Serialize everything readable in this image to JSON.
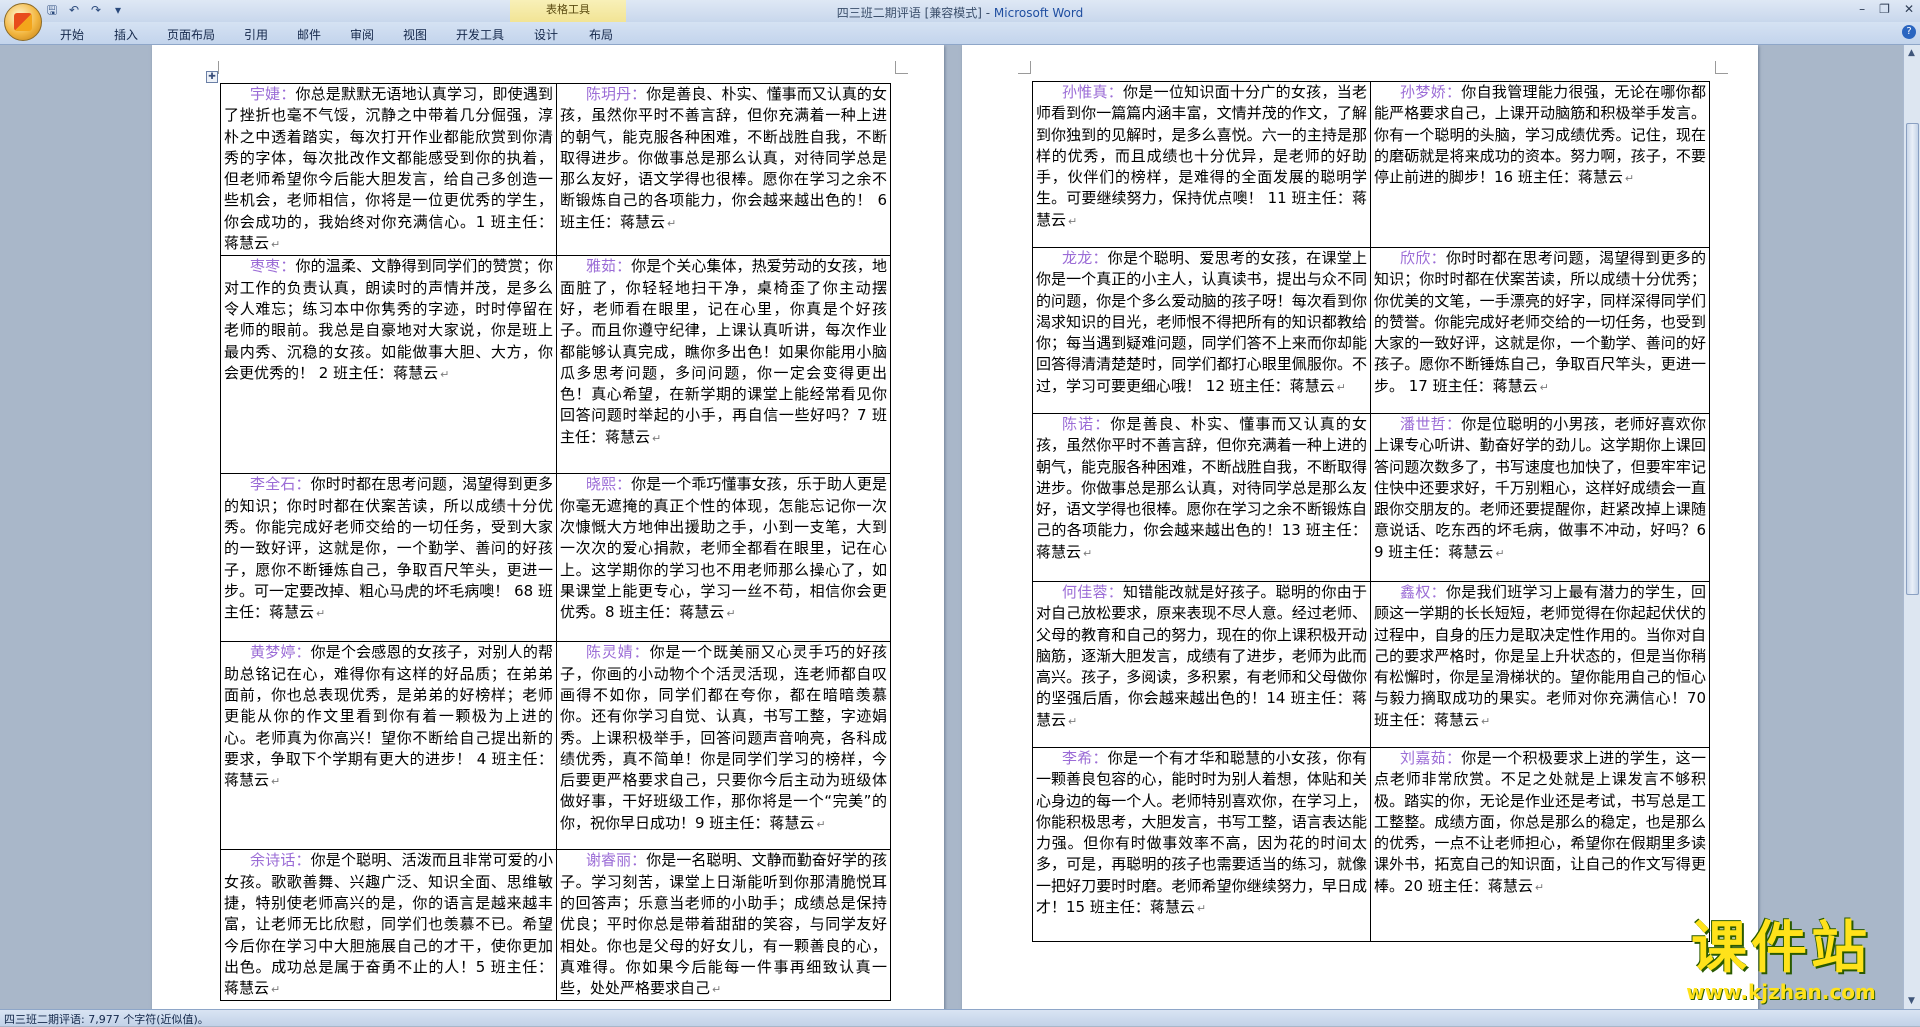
{
  "window": {
    "title_doc": "四三班二期评语 [兼容模式] - ",
    "title_app": "Microsoft Word",
    "context_group": "表格工具"
  },
  "tabs": [
    "开始",
    "插入",
    "页面布局",
    "引用",
    "邮件",
    "审阅",
    "视图",
    "开发工具",
    "设计",
    "布局"
  ],
  "status": {
    "text": "四三班二期评语: 7,977 个字符(近似值)。"
  },
  "watermark": {
    "title": "课件站",
    "url": "www.kjzhan.com"
  },
  "left_page": {
    "rows": [
      [
        {
          "name": "宇婕：",
          "text": "你总是默默无语地认真学习，即使遇到了挫折也毫不气馁，沉静之中带着几分倔强，淳朴之中透着踏实，每次打开作业都能欣赏到你清秀的字体，每次批改作文都能感受到你的执着，但老师希望你今后能大胆发言，给自己多创造一些机会，老师相信，你将是一位更优秀的学生，你会成功的，我始终对你充满信心。1 班主任：蒋慧云"
        },
        {
          "name": "陈玥丹：",
          "text": "你是善良、朴实、懂事而又认真的女孩，虽然你平时不善言辞，但你充满着一种上进的朝气，能克服各种困难，不断战胜自我，不断取得进步。你做事总是那么认真，对待同学总是那么友好，语文学得也很棒。愿你在学习之余不断锻炼自己的各项能力，你会越来越出色的！ 6 班主任：蒋慧云"
        }
      ],
      [
        {
          "name": "枣枣：",
          "text": "你的温柔、文静得到同学们的赞赏；你对工作的负责认真，朗读时的声情并茂，是多么令人难忘；练习本中你隽秀的字迹，时时停留在老师的眼前。我总是自豪地对大家说，你是班上最内秀、沉稳的女孩。如能做事大胆、大方，你会更优秀的！ 2 班主任：蒋慧云"
        },
        {
          "name": "雅茹：",
          "text": "你是个关心集体，热爱劳动的女孩，地面脏了，你轻轻地扫干净，桌椅歪了你主动摆好，老师看在眼里，记在心里，你真是个好孩子。而且你遵守纪律，上课认真听讲，每次作业都能够认真完成，瞧你多出色！如果你能用小脑瓜多思考问题，多问问题，你一定会变得更出色！真心希望，在新学期的课堂上能经常看见你回答问题时举起的小手，再自信一些好吗？7 班主任：蒋慧云"
        }
      ],
      [
        {
          "name": "李全石：",
          "text": "你时时都在思考问题，渴望得到更多的知识；你时时都在伏案苦读，所以成绩十分优秀。你能完成好老师交给的一切任务，受到大家的一致好评，这就是你，一个勤学、善问的好孩子，愿你不断锤炼自己，争取百尺竿头，更进一步。可一定要改掉、粗心马虎的坏毛病噢！ 68 班主任：蒋慧云"
        },
        {
          "name": "晓熙：",
          "text": "你是一个乖巧懂事女孩，乐于助人更是你毫无遮掩的真正个性的体现，怎能忘记你一次次慷慨大方地伸出援助之手，小到一支笔，大到一次次的爱心捐款，老师全都看在眼里，记在心上。这学期你的学习也不用老师那么操心了，如果课堂上能更专心，学习一丝不苟，相信你会更优秀。8 班主任：蒋慧云"
        }
      ],
      [
        {
          "name": "黄梦婷：",
          "text": "你是个会感恩的女孩子，对别人的帮助总铭记在心，难得你有这样的好品质；在弟弟面前，你也总表现优秀，是弟弟的好榜样；老师更能从你的作文里看到你有着一颗极为上进的心。老师真为你高兴！望你不断给自己提出新的要求，争取下个学期有更大的进步！ 4 班主任：蒋慧云"
        },
        {
          "name": "陈灵婧：",
          "text": "你是一个既美丽又心灵手巧的好孩子，你画的小动物个个活灵活现，连老师都自叹画得不如你，同学们都在夸你，都在暗暗羡慕你。还有你学习自觉、认真，书写工整，字迹娟秀。上课积极举手，回答问题声音响亮，各科成绩优秀，真不简单！你是同学们学习的榜样，今后要更严格要求自己，只要你今后主动为班级体做好事，干好班级工作，那你将是一个“完美”的你，祝你早日成功！9 班主任：蒋慧云"
        }
      ],
      [
        {
          "name": "余诗话：",
          "text": "你是个聪明、活泼而且非常可爱的小女孩。歌歌善舞、兴趣广泛、知识全面、思维敏捷，特别使老师高兴的是，你的语言是越来越丰富，让老师无比欣慰，同学们也羡慕不已。希望今后你在学习中大胆施展自己的才干，使你更加出色。成功总是属于奋勇不止的人！5 班主任：蒋慧云"
        },
        {
          "name": "谢睿丽：",
          "text": "你是一名聪明、文静而勤奋好学的孩子。学习刻苦，课堂上日渐能听到你那清脆悦耳的回答声；乐意当老师的小助手；成绩总是保持优良；平时你总是带着甜甜的笑容，与同学友好相处。你也是父母的好女儿，有一颗善良的心，真难得。你如果今后能每一件事再细致认真一些，处处严格要求自己"
        }
      ]
    ]
  },
  "right_page": {
    "rows": [
      [
        {
          "name": "孙惟真：",
          "text": "你是一位知识面十分广的女孩，当老师看到你一篇篇内涵丰富，文情并茂的作文，了解到你独到的见解时，是多么喜悦。六一的主持是那样的优秀，而且成绩也十分优异，是老师的好助手，伙伴们的榜样，是难得的全面发展的聪明学生。可要继续努力，保持优点噢！ 11 班主任：蒋慧云"
        },
        {
          "name": "孙梦娇：",
          "text": "你自我管理能力很强，无论在哪你都能严格要求自己，上课开动脑筋和积极举手发言。你有一个聪明的头脑，学习成绩优秀。记住，现在的磨砺就是将来成功的资本。努力啊，孩子，不要停止前进的脚步！16 班主任：蒋慧云"
        }
      ],
      [
        {
          "name": "龙龙：",
          "text": "你是个聪明、爱思考的女孩，在课堂上你是一个真正的小主人，认真读书，提出与众不同的问题，你是个多么爱动脑的孩子呀！每次看到你渴求知识的目光，老师恨不得把所有的知识都教给你；每当遇到疑难问题，同学们答不上来而你却能回答得清清楚楚时，同学们都打心眼里佩服你。不过，学习可要更细心哦！ 12 班主任：蒋慧云"
        },
        {
          "name": "欣欣：",
          "text": "你时时都在思考问题，渴望得到更多的知识；你时时都在伏案苦读，所以成绩十分优秀；你优美的文笔，一手漂亮的好字，同样深得同学们的赞誉。你能完成好老师交给的一切任务，也受到大家的一致好评，这就是你，一个勤学、善问的好孩子。愿你不断锤炼自己，争取百尺竿头，更进一步。 17 班主任：蒋慧云"
        }
      ],
      [
        {
          "name": "陈诺：",
          "text": "你是善良、朴实、懂事而又认真的女孩，虽然你平时不善言辞，但你充满着一种上进的朝气，能克服各种困难，不断战胜自我，不断取得进步。你做事总是那么认真，对待同学总是那么友好，语文学得也很棒。愿你在学习之余不断锻炼自己的各项能力，你会越来越出色的！13 班主任：蒋慧云"
        },
        {
          "name": "潘世哲：",
          "text": "你是位聪明的小男孩，老师好喜欢你上课专心听讲、勤奋好学的劲儿。这学期你上课回答问题次数多了，书写速度也加快了，但要牢牢记住快中还要求好，千万别粗心，这样好成绩会一直跟你交朋友的。老师还要提醒你，赶紧改掉上课随意说话、吃东西的坏毛病，做事不冲动，好吗？69 班主任：蒋慧云"
        }
      ],
      [
        {
          "name": "何佳蓉：",
          "text": "知错能改就是好孩子。聪明的你由于对自己放松要求，原来表现不尽人意。经过老师、父母的教育和自己的努力，现在的你上课积极开动脑筋，逐渐大胆发言，成绩有了进步，老师为此而高兴。孩子，多阅读，多积累，有老师和父母做你的坚强后盾，你会越来越出色的！14 班主任：蒋慧云"
        },
        {
          "name": "鑫权：",
          "text": "你是我们班学习上最有潜力的学生，回顾这一学期的长长短短，老师觉得在你起起伏伏的过程中，自身的压力是取决定性作用的。当你对自己的要求严格时，你是呈上升状态的，但是当你稍有松懈时，你是呈滑梯状的。望你能用自己的恒心与毅力摘取成功的果实。老师对你充满信心！70 班主任：蒋慧云"
        }
      ],
      [
        {
          "name": "李希：",
          "text": "你是一个有才华和聪慧的小女孩，你有一颗善良包容的心，能时时为别人着想，体贴和关心身边的每一个人。老师特别喜欢你，在学习上，你能积极思考，大胆发言，书写工整，语言表达能力强。但你有时做事效率不高，因为花的时间太多，可是，再聪明的孩子也需要适当的练习，就像一把好刀要时时磨。老师希望你继续努力，早日成才！15 班主任：蒋慧云"
        },
        {
          "name": "刘嘉茹：",
          "text": "你是一个积极要求上进的学生，这一点老师非常欣赏。不足之处就是上课发言不够积极。踏实的你，无论是作业还是考试，书写总是工工整整。成绩方面，你总是那么的稳定，也是那么的优秀，一点不让老师担心，希望你在假期里多读课外书，拓宽自己的知识面，让自己的作文写得更棒。20 班主任：蒋慧云"
        }
      ]
    ]
  }
}
